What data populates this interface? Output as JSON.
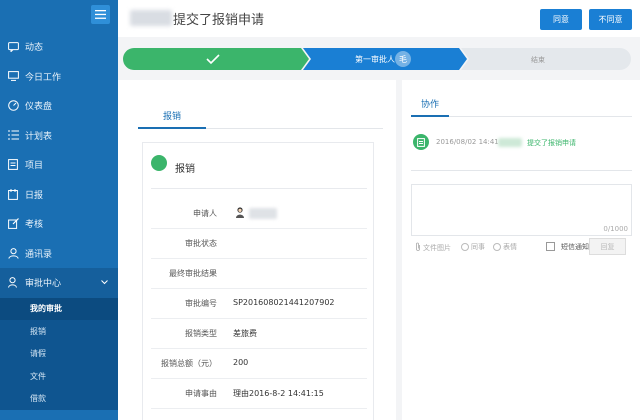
{
  "sidebar": {
    "items": [
      {
        "label": "动态",
        "icon": "chat-icon"
      },
      {
        "label": "今日工作",
        "icon": "monitor-icon"
      },
      {
        "label": "仪表盘",
        "icon": "dashboard-icon"
      },
      {
        "label": "计划表",
        "icon": "list-icon"
      },
      {
        "label": "项目",
        "icon": "document-icon"
      },
      {
        "label": "日报",
        "icon": "daily-icon"
      },
      {
        "label": "考核",
        "icon": "edit-icon"
      },
      {
        "label": "通讯录",
        "icon": "user-icon"
      },
      {
        "label": "审批中心",
        "icon": "approval-icon"
      }
    ],
    "sub_items": [
      "我的审批",
      "报销",
      "请假",
      "文件",
      "借款"
    ]
  },
  "header": {
    "title": "提交了报销申请",
    "agree_label": "同意",
    "disagree_label": "不同意"
  },
  "progress": {
    "steps": [
      "",
      "第一审批人",
      "结束"
    ],
    "approver_badge": "毛",
    "colors": {
      "done": "#3bb56b",
      "current": "#1a7fd4",
      "pending": "#e4e8ec"
    }
  },
  "form": {
    "tab_label": "报销",
    "card_title": "报销",
    "rows": [
      {
        "label": "申请人",
        "value": ""
      },
      {
        "label": "审批状态",
        "value": ""
      },
      {
        "label": "最终审批结果",
        "value": ""
      },
      {
        "label": "审批编号",
        "value": "SP201608021441207902"
      },
      {
        "label": "报销类型",
        "value": "差旅费"
      },
      {
        "label": "报销总额（元）",
        "value": "200"
      },
      {
        "label": "申请事由",
        "value": "理由2016-8-2 14:41:15"
      }
    ]
  },
  "collab": {
    "tab_label": "协作",
    "log_time": "2016/08/02 14:41",
    "log_action": "提交了报销申请",
    "counter": "0/1000",
    "tool_file": "文件图片",
    "tool_mention": "同事",
    "tool_emoji": "表情",
    "sms_label": "短信通知",
    "reply_label": "回复"
  }
}
